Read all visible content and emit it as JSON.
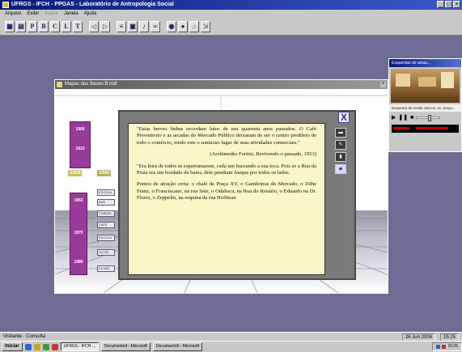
{
  "app": {
    "title": "UFRGS - IFCH - PPGAS - Laboratório de Antropologia Social"
  },
  "menu": [
    {
      "label": "Arquivo",
      "dim": false
    },
    {
      "label": "Exibir",
      "dim": false
    },
    {
      "label": "Inserir",
      "dim": true
    },
    {
      "label": "Janela",
      "dim": false
    },
    {
      "label": "Ajuda",
      "dim": false
    }
  ],
  "toolbar": [
    "P",
    "B",
    "C",
    "L",
    "T"
  ],
  "image_window": {
    "title": "Mapas das Bases B.mdl"
  },
  "scene": {
    "years": [
      "1900",
      "1910",
      "1928",
      "1940",
      "1953",
      "1970",
      "1980"
    ],
    "signs": [
      "ESCOLA",
      "BAR",
      "CINEMA",
      "CAFÉ",
      "ESCOLA",
      "HOTEL",
      "CLUBE"
    ]
  },
  "popup": {
    "close_label": "X",
    "paragraphs": [
      "\"Estas breves linhas recordam fatos de uns quarenta anos passados. O Café Preventorio e as arcadas do Mercado Público deixaram de ser o centro predileto de todo o comércio, tendo este o suntuoso lugar de suas atividades comerciais.\"",
      "(Archimedes Fortini, Revivendo o passado, 1953)",
      "\"Era hora de todos se esparramarem, cada um buscando a sua toca. Pois se a Rua da Praia era um bordado de bares, dele pendiam franjas por todos os lados.",
      "Pontos de atração certa: o chalé da Praça XV, o Gambrinus do Mercado, o Zithe Franz, o Franciscano, na rua Sete, o Odalisca, na Rua do Rosário, o Eduardo na Dr. Flores, o Zeppelin, na esquina da rua Hoffman"
    ],
    "side_tools": [
      "▬",
      "✎",
      "▮",
      "◆"
    ]
  },
  "player": {
    "title": "Esquentas do arrau...",
    "caption": "Esquenta de ronda: barcos, av. praça...",
    "controls": [
      "▶",
      "❚❚",
      "■"
    ]
  },
  "status": {
    "left": "Visitante · Consulta",
    "date": "26 Jun 2006",
    "time": "15:25"
  },
  "taskbar": {
    "start": "Iniciar",
    "tasks": [
      {
        "label": "UFRGS - IFCH ...",
        "active": true
      },
      {
        "label": "Documento4 - Microsoft",
        "active": false
      },
      {
        "label": "Documento5 - Microsoft",
        "active": false
      }
    ],
    "clock": "15:25"
  }
}
